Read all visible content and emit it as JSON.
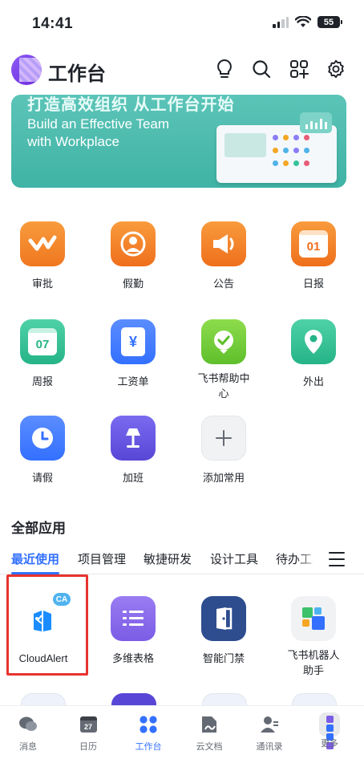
{
  "status_bar": {
    "time": "14:41",
    "battery": "55"
  },
  "header": {
    "title": "工作台"
  },
  "banner": {
    "headline": "打造高效组织 从工作台开始",
    "subtitle_line1": "Build an Effective Team",
    "subtitle_line2": "with Workplace"
  },
  "common_apps": [
    {
      "label": "审批"
    },
    {
      "label": "假勤"
    },
    {
      "label": "公告"
    },
    {
      "label": "日报",
      "icon_text": "01"
    },
    {
      "label": "周报",
      "icon_text": "07"
    },
    {
      "label": "工资单",
      "icon_text": "¥"
    },
    {
      "label": "飞书帮助中心"
    },
    {
      "label": "外出"
    },
    {
      "label": "请假"
    },
    {
      "label": "加班"
    },
    {
      "label": "添加常用"
    }
  ],
  "all_apps": {
    "title": "全部应用",
    "tabs": [
      "最近使用",
      "项目管理",
      "敏捷研发",
      "设计工具",
      "待办工具"
    ],
    "active_tab": "最近使用",
    "apps": [
      {
        "label": "CloudAlert",
        "badge": "CA"
      },
      {
        "label": "多维表格"
      },
      {
        "label": "智能门禁"
      },
      {
        "label": "飞书机器人助手"
      }
    ]
  },
  "bottom_nav": [
    {
      "label": "消息",
      "icon": "chat-icon"
    },
    {
      "label": "日历",
      "icon": "calendar-icon",
      "icon_text": "27"
    },
    {
      "label": "工作台",
      "icon": "workplace-icon",
      "active": true
    },
    {
      "label": "云文档",
      "icon": "docs-icon"
    },
    {
      "label": "通讯录",
      "icon": "contacts-icon"
    },
    {
      "label": "更多",
      "icon": "more-apps-icon"
    }
  ],
  "colors": {
    "accent": "#3370ff",
    "orange": "#f5822a",
    "green": "#34c29a",
    "blue": "#3370ff",
    "purple": "#6f59d9",
    "highlight": "#e8332f"
  }
}
